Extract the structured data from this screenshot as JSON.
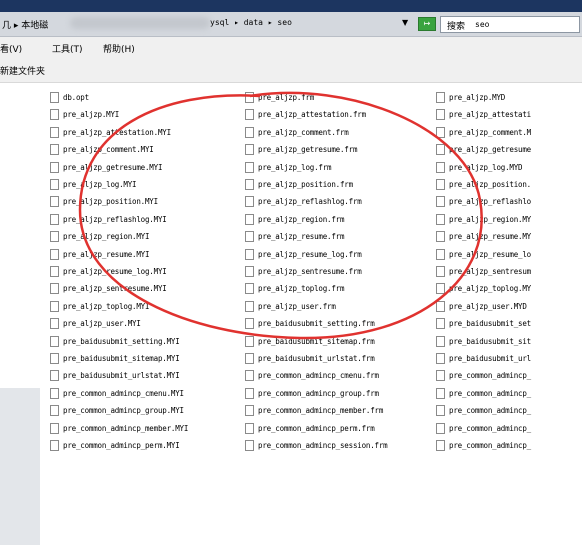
{
  "address": {
    "left_text": "几 ▸ 本地磁",
    "path_text": "ysql ▸ data ▸ seo",
    "dropdown_arrow": "▼",
    "go_icon": "go-icon"
  },
  "search": {
    "label": "搜索",
    "value": "seo"
  },
  "menu": {
    "items": [
      "看(V)",
      "工具(T)",
      "帮助(H)"
    ]
  },
  "toolbar": {
    "new_folder": "新建文件夹"
  },
  "files": {
    "col1": [
      "db.opt",
      "pre_aljzp.MYI",
      "pre_aljzp_attestation.MYI",
      "pre_aljzp_comment.MYI",
      "pre_aljzp_getresume.MYI",
      "pre_aljzp_log.MYI",
      "pre_aljzp_position.MYI",
      "pre_aljzp_reflashlog.MYI",
      "pre_aljzp_region.MYI",
      "pre_aljzp_resume.MYI",
      "pre_aljzp_resume_log.MYI",
      "pre_aljzp_sentresume.MYI",
      "pre_aljzp_toplog.MYI",
      "pre_aljzp_user.MYI",
      "pre_baidusubmit_setting.MYI",
      "pre_baidusubmit_sitemap.MYI",
      "pre_baidusubmit_urlstat.MYI",
      "pre_common_admincp_cmenu.MYI",
      "pre_common_admincp_group.MYI",
      "pre_common_admincp_member.MYI",
      "pre_common_admincp_perm.MYI"
    ],
    "col2": [
      "pre_aljzp.frm",
      "pre_aljzp_attestation.frm",
      "pre_aljzp_comment.frm",
      "pre_aljzp_getresume.frm",
      "pre_aljzp_log.frm",
      "pre_aljzp_position.frm",
      "pre_aljzp_reflashlog.frm",
      "pre_aljzp_region.frm",
      "pre_aljzp_resume.frm",
      "pre_aljzp_resume_log.frm",
      "pre_aljzp_sentresume.frm",
      "pre_aljzp_toplog.frm",
      "pre_aljzp_user.frm",
      "pre_baidusubmit_setting.frm",
      "pre_baidusubmit_sitemap.frm",
      "pre_baidusubmit_urlstat.frm",
      "pre_common_admincp_cmenu.frm",
      "pre_common_admincp_group.frm",
      "pre_common_admincp_member.frm",
      "pre_common_admincp_perm.frm",
      "pre_common_admincp_session.frm"
    ],
    "col3": [
      "pre_aljzp.MYD",
      "pre_aljzp_attestati",
      "pre_aljzp_comment.M",
      "pre_aljzp_getresume",
      "pre_aljzp_log.MYD",
      "pre_aljzp_position.",
      "pre_aljzp_reflashlo",
      "pre_aljzp_region.MY",
      "pre_aljzp_resume.MY",
      "pre_aljzp_resume_lo",
      "pre_aljzp_sentresum",
      "pre_aljzp_toplog.MY",
      "pre_aljzp_user.MYD",
      "pre_baidusubmit_set",
      "pre_baidusubmit_sit",
      "pre_baidusubmit_url",
      "pre_common_admincp_",
      "pre_common_admincp_",
      "pre_common_admincp_",
      "pre_common_admincp_",
      "pre_common_admincp_"
    ]
  },
  "colors": {
    "annotation": "#e0322f",
    "chrome": "#d4d8de",
    "menubar": "#f0f0f0"
  }
}
